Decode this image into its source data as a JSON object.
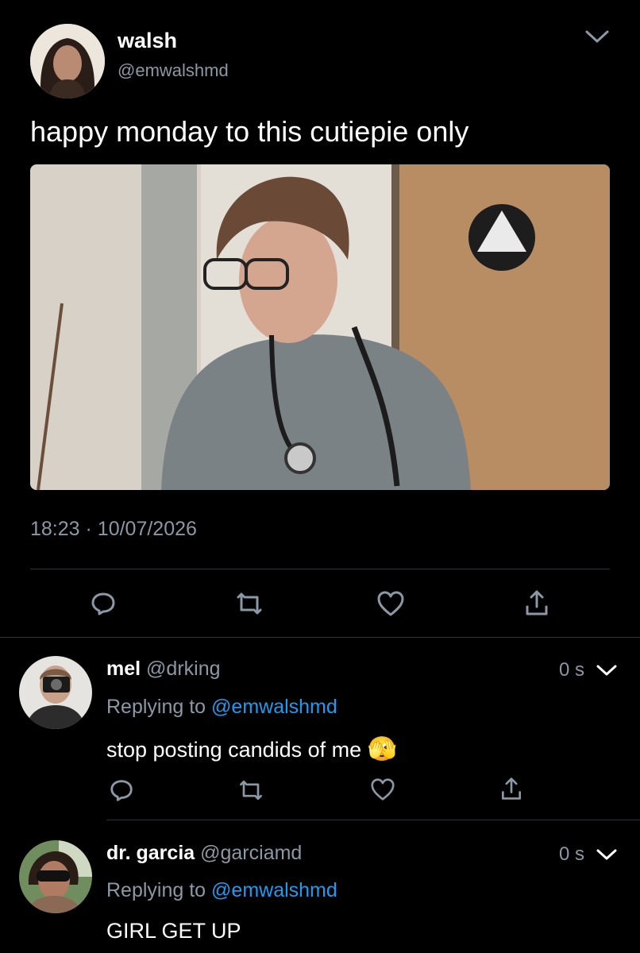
{
  "tweet": {
    "author_name": "walsh",
    "author_handle": "@emwalshmd",
    "text": "happy monday to this cutiepie only",
    "time": "18:23",
    "dot": "·",
    "date": "10/07/2026"
  },
  "replies": [
    {
      "name": "mel",
      "handle": "@drking",
      "time": "0 s",
      "replying_label": "Replying to",
      "replying_handle": "@emwalshmd",
      "text": "stop posting candids of me",
      "emoji": "🫣"
    },
    {
      "name": "dr. garcia",
      "handle": "@garciamd",
      "time": "0 s",
      "replying_label": "Replying to",
      "replying_handle": "@emwalshmd",
      "text": "GIRL GET UP"
    }
  ],
  "icons": {
    "reply": "reply-icon",
    "retweet": "retweet-icon",
    "like": "heart-icon",
    "share": "share-icon",
    "more": "chevron-down-icon"
  },
  "colors": {
    "background": "#000000",
    "text": "#ffffff",
    "muted": "#8b98a5",
    "link": "#1d9bf0",
    "divider": "#2f3336"
  }
}
